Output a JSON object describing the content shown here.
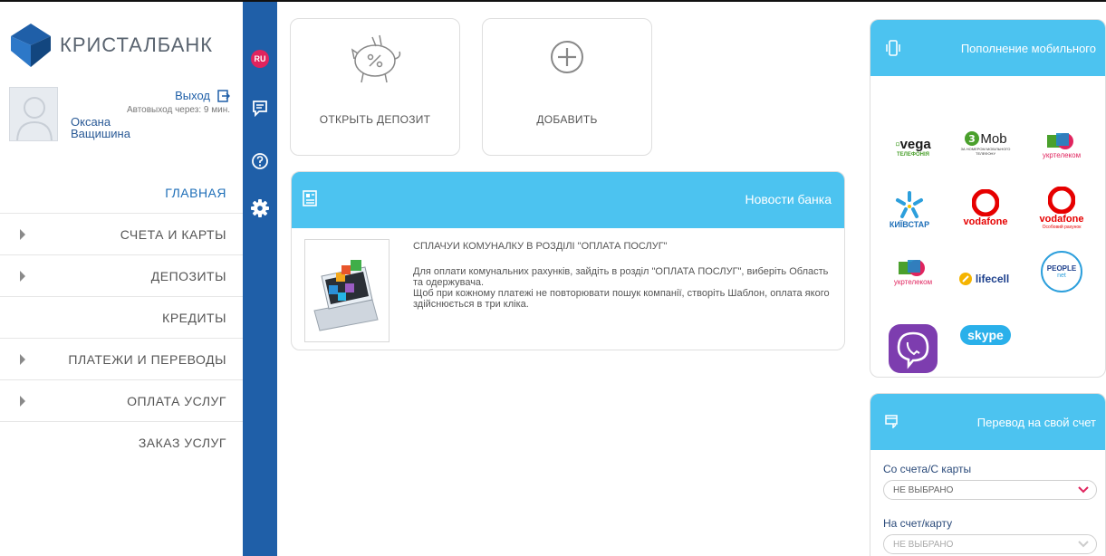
{
  "brand": {
    "name": "КРИСТАЛБАНК",
    "accent": "#4cc3f0",
    "dark": "#1f5fa8"
  },
  "user": {
    "logout_label": "Выход",
    "autologout": "Автовыход через: 9 мин.",
    "first_name": "Оксана",
    "last_name": "Ващишина"
  },
  "menu": [
    {
      "label": "ГЛАВНАЯ",
      "expandable": false
    },
    {
      "label": "СЧЕТА И КАРТЫ",
      "expandable": true
    },
    {
      "label": "ДЕПОЗИТЫ",
      "expandable": true
    },
    {
      "label": "КРЕДИТЫ",
      "expandable": false
    },
    {
      "label": "ПЛАТЕЖИ И ПЕРЕВОДЫ",
      "expandable": true
    },
    {
      "label": "ОПЛАТА УСЛУГ",
      "expandable": true
    },
    {
      "label": "ЗАКАЗ УСЛУГ",
      "expandable": false
    }
  ],
  "iconbar": {
    "lang": "RU"
  },
  "tiles": {
    "deposit_label": "ОТКРЫТЬ ДЕПОЗИТ",
    "add_label": "ДОБАВИТЬ"
  },
  "news": {
    "header": "Новости банка",
    "title": "СПЛАЧУИ КОМУНАЛКУ В РОЗДІЛІ \"ОПЛАТА ПОСЛУГ\"",
    "body_1": "Для оплати комунальних рахунків, зайдіть в розділ \"ОПЛАТА ПОСЛУГ\", виберіть Область та одержувача.",
    "body_2": "Щоб при кожному платежі не повторювати пошук компанії, створіть Шаблон, оплата якого здійснюється в три кліка."
  },
  "mobile": {
    "header": "Пополнение мобильного",
    "operators": {
      "vega": "vega",
      "vega_sub": "ТЕЛЕФОНІЯ",
      "mob": "Mob",
      "mob_sub": "ЗА НОМЕРОМ МОБІЛЬНОГО ТЕЛЕФОНУ",
      "ukrtelecom": "укртелеком",
      "kyivstar": "КИЇВСТАР",
      "vodafone": "vodafone",
      "vodafone_sub": "Особовий рахунок",
      "lifecell": "lifecell",
      "people": "PEOPLE",
      "people_sub": "net",
      "skype": "skype"
    }
  },
  "transfer": {
    "header": "Перевод на свой счет",
    "from_label": "Со счета/С карты",
    "from_value": "НЕ ВЫБРАНО",
    "to_label": "На счет/карту",
    "to_value": "НЕ ВЫБРАНО"
  }
}
